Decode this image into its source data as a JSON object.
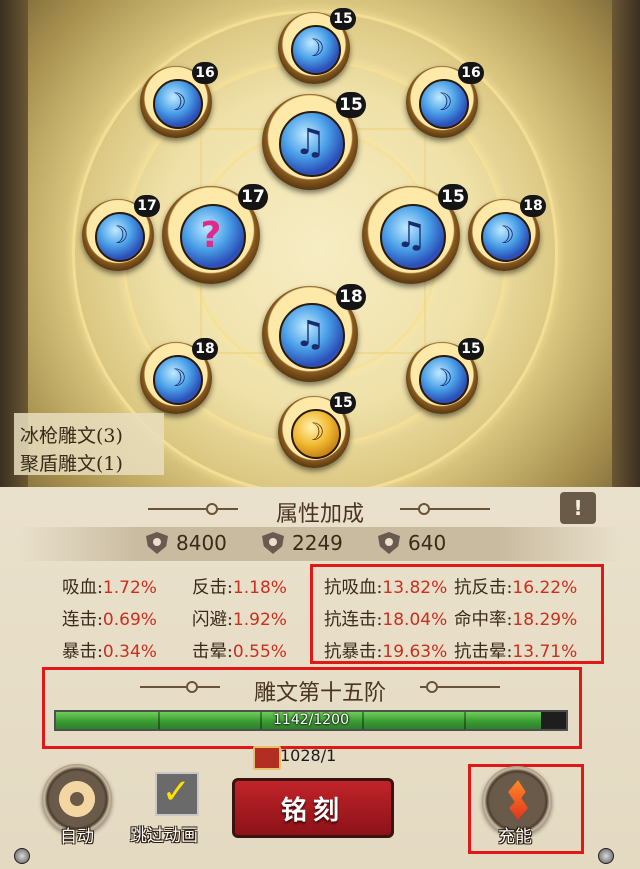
{
  "runes": [
    {
      "level": "15",
      "glyph": "☽",
      "type": "small"
    },
    {
      "level": "16",
      "glyph": "☽",
      "type": "small"
    },
    {
      "level": "16",
      "glyph": "☽",
      "type": "small"
    },
    {
      "level": "15",
      "glyph": "♫",
      "type": "big"
    },
    {
      "level": "17",
      "glyph": "☽",
      "type": "small"
    },
    {
      "level": "17",
      "glyph": "?",
      "type": "big"
    },
    {
      "level": "15",
      "glyph": "♫",
      "type": "big"
    },
    {
      "level": "18",
      "glyph": "☽",
      "type": "small"
    },
    {
      "level": "18",
      "glyph": "♫",
      "type": "big"
    },
    {
      "level": "18",
      "glyph": "☽",
      "type": "small"
    },
    {
      "level": "15",
      "glyph": "☽",
      "type": "small"
    },
    {
      "level": "15",
      "glyph": "☽",
      "type": "gold"
    }
  ],
  "rune_sets": [
    "冰枪雕文(3)",
    "聚盾雕文(1)"
  ],
  "panel_title": "属性加成",
  "info_label": "!",
  "stats": {
    "hp": "8400",
    "attack": "2249",
    "defense": "640"
  },
  "attributes_left": [
    {
      "name": "吸血:",
      "value": "1.72%"
    },
    {
      "name": "反击:",
      "value": "1.18%"
    },
    {
      "name": "连击:",
      "value": "0.69%"
    },
    {
      "name": "闪避:",
      "value": "1.92%"
    },
    {
      "name": "暴击:",
      "value": "0.34%"
    },
    {
      "name": "击晕:",
      "value": "0.55%"
    }
  ],
  "attributes_right": [
    {
      "name": "抗吸血:",
      "value": "13.82%"
    },
    {
      "name": "抗反击:",
      "value": "16.22%"
    },
    {
      "name": "抗连击:",
      "value": "18.04%"
    },
    {
      "name": "命中率:",
      "value": "18.29%"
    },
    {
      "name": "抗暴击:",
      "value": "19.63%"
    },
    {
      "name": "抗击晕:",
      "value": "13.71%"
    }
  ],
  "tier_title": "雕文第十五阶",
  "progress": {
    "text": "1142/1200",
    "current": 1142,
    "max": 1200
  },
  "cost": "1028/1",
  "buttons": {
    "auto": "自动",
    "skip": "跳过动画",
    "engrave": "铭刻",
    "charge": "充能"
  },
  "skip_checked": true,
  "colors": {
    "highlight_box": "#e01818",
    "engrave_button": "#b01c22",
    "progress_fill": "#4aae3c",
    "attr_value": "#c7301f"
  }
}
